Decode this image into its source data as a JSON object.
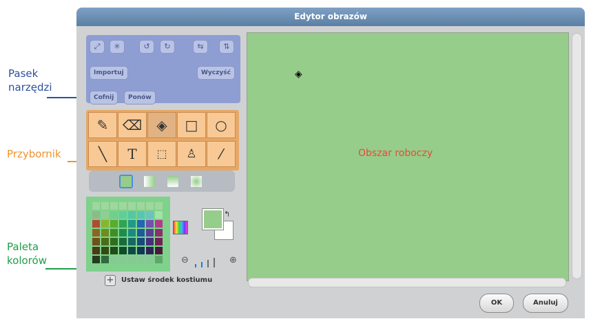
{
  "annotations": {
    "toolbar": [
      "Pasek",
      "narzędzi"
    ],
    "toolbox": "Przybornik",
    "palette": [
      "Paleta",
      "kolorów"
    ]
  },
  "dialog": {
    "title": "Edytor obrazów",
    "toolbar": {
      "icons": [
        "grow-icon",
        "shrink-icon",
        "rotate-left-icon",
        "rotate-right-icon",
        "flip-horizontal-icon",
        "flip-vertical-icon"
      ],
      "import_label": "Importuj",
      "clear_label": "Wyczyść",
      "undo_label": "Cofnij",
      "redo_label": "Ponów"
    },
    "toolbox": {
      "tools": [
        "paintbrush-icon",
        "eraser-icon",
        "paint-bucket-icon",
        "rectangle-icon",
        "ellipse-icon",
        "line-icon",
        "text-icon",
        "select-icon",
        "stamp-icon",
        "eyedropper-icon"
      ],
      "text_tool_glyph": "T",
      "selected": "paint-bucket-icon"
    },
    "fill_modes": [
      "solid",
      "horizontal-gradient",
      "vertical-gradient",
      "radial-gradient"
    ],
    "colors": {
      "foreground": "#96cd8a",
      "background": "#ffffff",
      "palette_bg": "#7fd18c",
      "swatches": [
        [
          "#a0d79e",
          "#a0d79e",
          "#a0d79e",
          "#a0d79e",
          "#a0d79e",
          "#a0d79e",
          "#a0d79e",
          "#a0d79e"
        ],
        [
          "#8fb98a",
          "#8fcf93",
          "#6fd08d",
          "#5ecf9a",
          "#52c8a4",
          "#57c6b4",
          "#6bc2c0",
          "#9fe3a7"
        ],
        [
          "#b34a30",
          "#8bb42e",
          "#5bab2c",
          "#2fa552",
          "#219a86",
          "#2167b5",
          "#7451b0",
          "#b43b8c"
        ],
        [
          "#8f6420",
          "#6f8d1c",
          "#3f8f26",
          "#1e8c4c",
          "#1a8a82",
          "#1c5c9a",
          "#5a3f96",
          "#8f2d70"
        ],
        [
          "#70501c",
          "#4c6c18",
          "#2f6e20",
          "#186b3c",
          "#156a63",
          "#184b7d",
          "#44307a",
          "#6f2256"
        ],
        [
          "#4d3818",
          "#334a14",
          "#204c18",
          "#124a2c",
          "#104a46",
          "#133659",
          "#2f2257",
          "#4b183b"
        ],
        [
          "#243c1f",
          "#2f6a3c",
          "#86c995",
          "#86c995",
          "#86c995",
          "#86c995",
          "#86c995",
          "#5ea669"
        ]
      ]
    },
    "zoom": {
      "level": 2,
      "max": 4
    },
    "canvas": {
      "label": "Obszar roboczy",
      "background": "#96cd8a"
    },
    "set_center_label": "Ustaw środek kostiumu",
    "ok_label": "OK",
    "cancel_label": "Anuluj"
  }
}
